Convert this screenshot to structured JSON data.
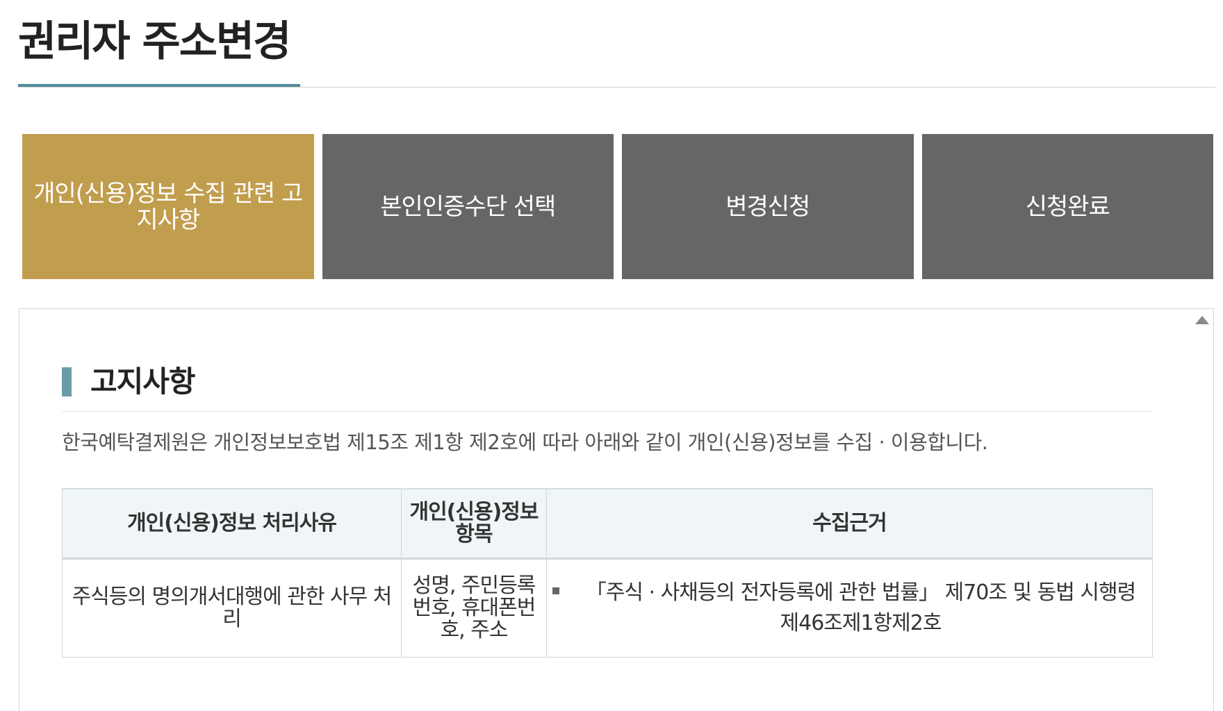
{
  "page": {
    "title": "권리자 주소변경"
  },
  "steps": [
    {
      "label": "개인(신용)정보 수집 관련 고지사항",
      "active": true
    },
    {
      "label": "본인인증수단 선택",
      "active": false
    },
    {
      "label": "변경신청",
      "active": false
    },
    {
      "label": "신청완료",
      "active": false
    }
  ],
  "notice": {
    "heading": "고지사항",
    "text": "한국예탁결제원은 개인정보보호법 제15조 제1항 제2호에 따라 아래와 같이 개인(신용)정보를 수집 · 이용합니다.",
    "table": {
      "headers": [
        "개인(신용)정보 처리사유",
        "개인(신용)정보 항목",
        "수집근거"
      ],
      "rows": [
        {
          "reason": "주식등의 명의개서대행에 관한 사무 처리",
          "items": "성명, 주민등록번호, 휴대폰번호, 주소",
          "basis": "「주식 · 사채등의 전자등록에 관한 법률」 제70조 및 동법 시행령 제46조제1항제2호"
        }
      ]
    }
  },
  "colors": {
    "step_active": "#c19d4e",
    "step_inactive": "#666666",
    "accent": "#4f8a9a",
    "table_header_bg": "#f0f6f8"
  },
  "icons": {
    "scroll_up": "triangle-up",
    "bullet": "square"
  }
}
